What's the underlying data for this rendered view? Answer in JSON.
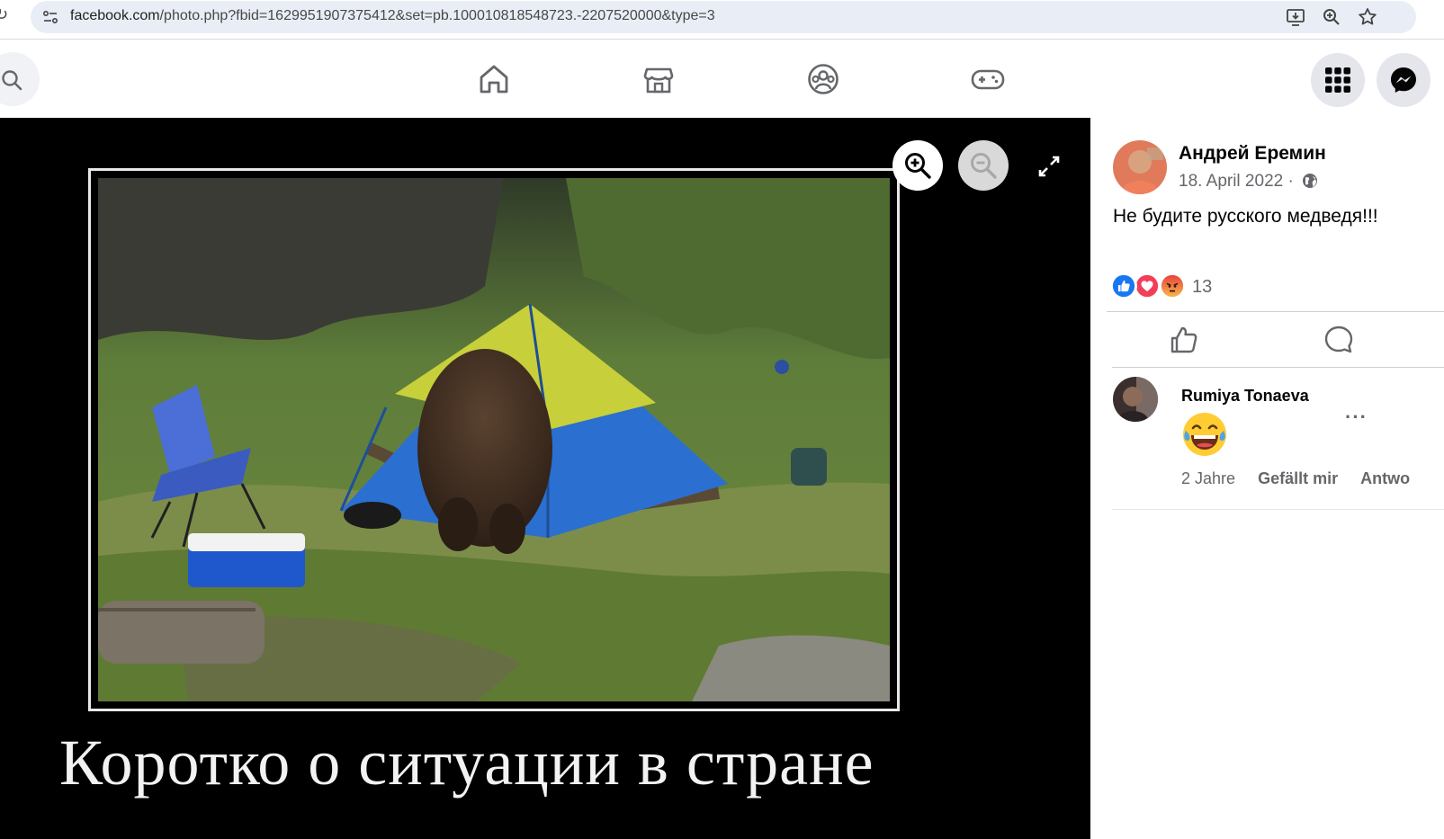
{
  "browser": {
    "url_host": "facebook.com",
    "url_path": "/photo.php?fbid=1629951907375412&set=pb.100010818548723.-2207520000&type=3"
  },
  "photo": {
    "caption": "Коротко о ситуации в стране"
  },
  "post": {
    "author": "Андрей Еремин",
    "date": "18. April 2022",
    "separator": "·",
    "text": "Не будите русского медведя!!!",
    "reaction_count": "13"
  },
  "comment": {
    "author": "Rumiya Tonaeva",
    "emoji": "laughing-tears",
    "more": "···",
    "age": "2 Jahre",
    "like": "Gefällt mir",
    "reply": "Antwo"
  },
  "colors": {
    "fb_blue": "#1877f2",
    "love_red": "#f33e58",
    "angry_orange": "#f7714c",
    "text_secondary": "#65676b"
  }
}
